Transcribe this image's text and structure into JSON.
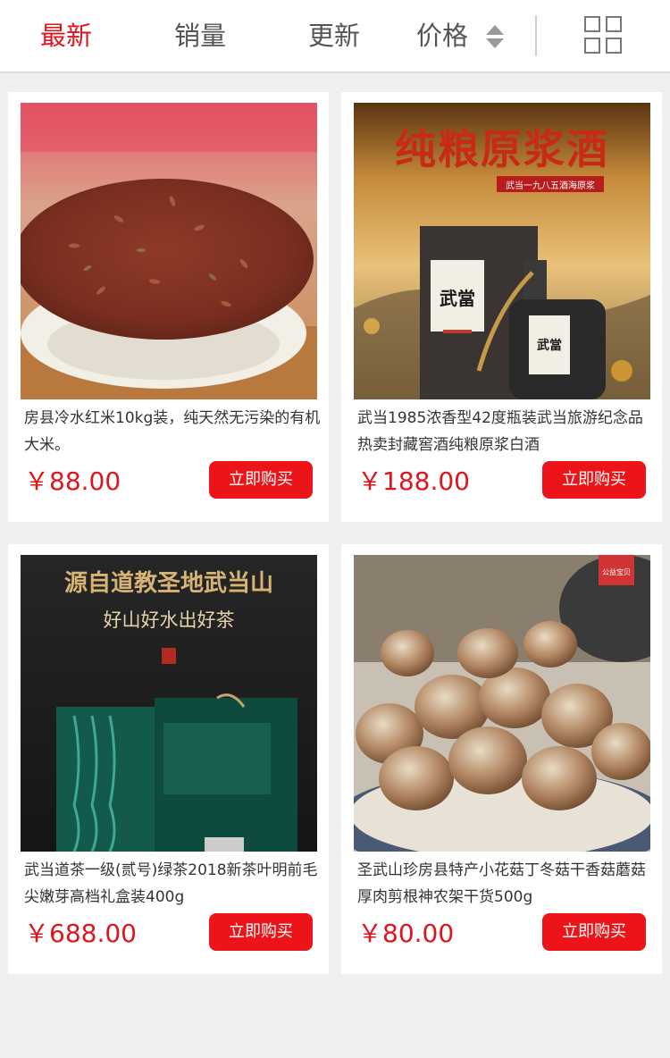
{
  "sort_tabs": {
    "newest": "最新",
    "sales": "销量",
    "update": "更新",
    "price": "价格"
  },
  "colors": {
    "accent": "#e0141d",
    "button": "#ec1418",
    "background": "#efeff1"
  },
  "icons": {
    "price_sort": "sort-updown-icon",
    "view_toggle": "grid-view-icon"
  },
  "products": [
    {
      "title": "房县冷水红米10kg装，纯天然无污染的有机大米。",
      "price": "￥88.00",
      "buy_label": "立即购买"
    },
    {
      "title": "武当1985浓香型42度瓶装武当旅游纪念品热卖封藏窖酒纯粮原浆白酒",
      "price": "￥188.00",
      "buy_label": "立即购买",
      "image_text": {
        "headline": "纯粮原浆酒",
        "ribbon": "武当一九八五酒海原浆",
        "brand": "武當"
      }
    },
    {
      "title": "武当道茶一级(贰号)绿茶2018新茶叶明前毛尖嫩芽高档礼盒装400g",
      "price": "￥688.00",
      "buy_label": "立即购买",
      "image_text": {
        "headline": "源自道教圣地武当山",
        "subline": "好山好水出好茶"
      }
    },
    {
      "title": "圣武山珍房县特产小花菇丁冬菇干香菇蘑菇厚肉剪根神农架干货500g",
      "price": "￥80.00",
      "buy_label": "立即购买",
      "image_text": {
        "badge": "公益宝贝"
      }
    }
  ]
}
